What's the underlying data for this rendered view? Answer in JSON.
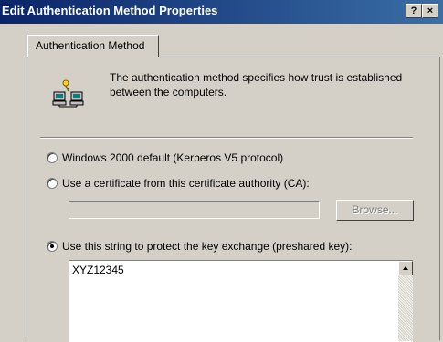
{
  "window": {
    "title": "Edit Authentication Method Properties",
    "help_button": "?",
    "close_button": "×"
  },
  "tabs": [
    {
      "label": "Authentication Method",
      "selected": true
    }
  ],
  "description": "The authentication method specifies how trust is established between the computers.",
  "icon": "network-computers-key-icon",
  "options": [
    {
      "label": "Windows 2000 default (Kerberos V5 protocol)",
      "checked": false
    },
    {
      "label": "Use a certificate from this certificate authority (CA):",
      "checked": false
    },
    {
      "label": "Use this string to protect the key exchange (preshared key):",
      "checked": true
    }
  ],
  "certificate": {
    "value": "",
    "browse_label": "Browse..."
  },
  "preshared_key": {
    "value": "XYZ12345"
  },
  "colors": {
    "titlebar_start": "#0a246a",
    "titlebar_end": "#3a6ea5",
    "face": "#d4d0c8"
  }
}
